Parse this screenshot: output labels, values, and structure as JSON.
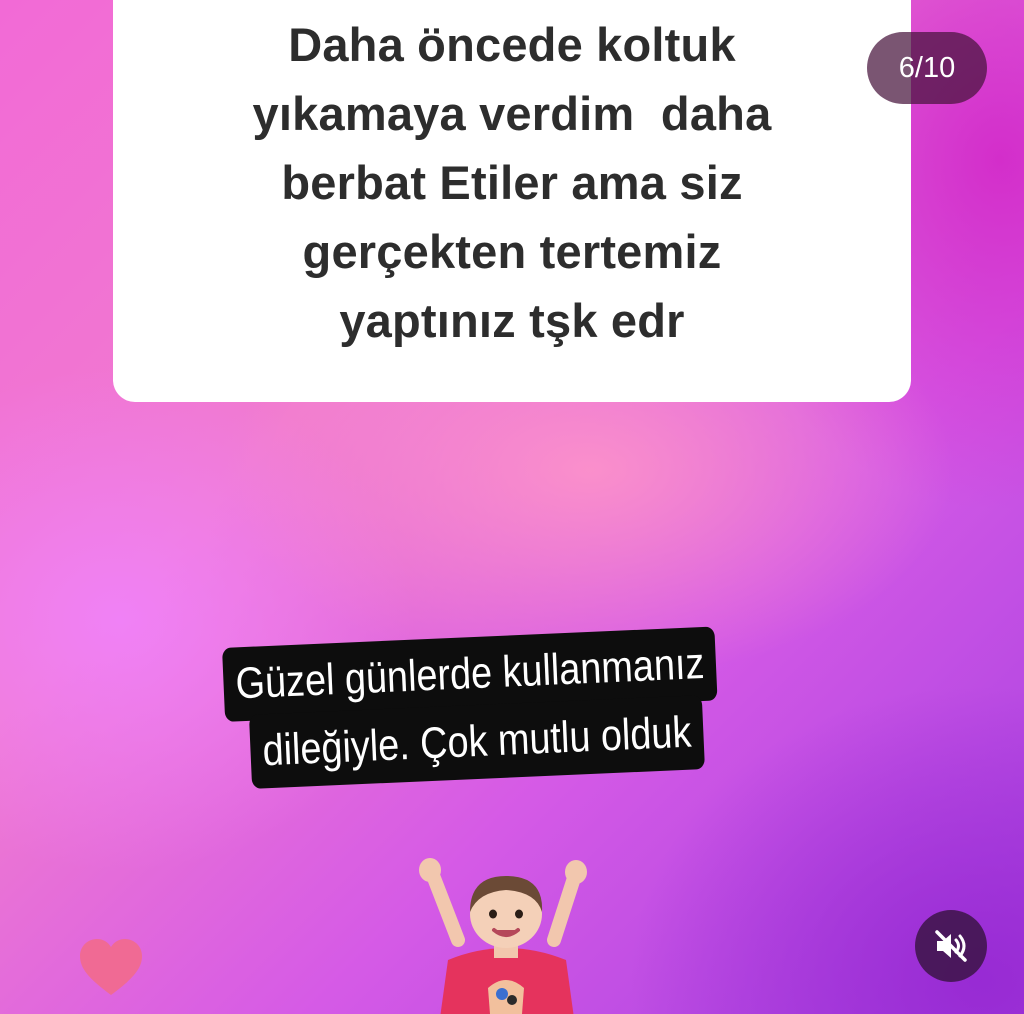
{
  "story": {
    "counter": "6/10",
    "question_lines": [
      "Daha öncede koltuk",
      "yıkamaya verdim  daha",
      "berbat Etiler ama siz",
      "gerçekten tertemiz",
      "yaptınız tşk edr"
    ],
    "reply_lines": [
      "Güzel günlerde kullanmanız",
      "dileğiyle. Çok mutlu olduk"
    ]
  },
  "controls": {
    "like_icon": "heart-icon",
    "mute_icon": "speaker-muted-icon"
  },
  "colors": {
    "heart": "#f06a94",
    "card": "#ffffff",
    "card_text": "#2d2d2d",
    "sticker_bg": "#0d0d0d"
  }
}
